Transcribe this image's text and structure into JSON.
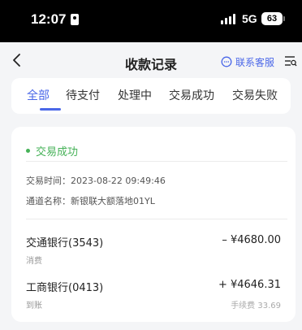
{
  "status_bar": {
    "time": "12:07",
    "network": "5G",
    "battery": "63"
  },
  "header": {
    "title": "收款记录",
    "service_label": "联系客服",
    "icons": [
      "back-chevron-icon",
      "chat-bubble-icon",
      "filter-list-icon"
    ]
  },
  "tabs": [
    {
      "label": "全部",
      "active": true
    },
    {
      "label": "待支付",
      "active": false
    },
    {
      "label": "处理中",
      "active": false
    },
    {
      "label": "交易成功",
      "active": false
    },
    {
      "label": "交易失败",
      "active": false
    }
  ],
  "record": {
    "status": "交易成功",
    "status_color": "#46b258",
    "time_line": "交易时间：2023-08-22 09:49:46",
    "channel_line": "通道名称：新银联大额落地01YL",
    "payer": {
      "bank": "交通银行(3543)",
      "type": "消费",
      "amount": "– ¥4680.00"
    },
    "payee": {
      "bank": "工商银行(0413)",
      "type": "到账",
      "amount": "+ ¥4646.31",
      "fee": "手续费 33.69"
    }
  },
  "colors": {
    "accent": "#4a67e8",
    "success": "#46b258"
  }
}
